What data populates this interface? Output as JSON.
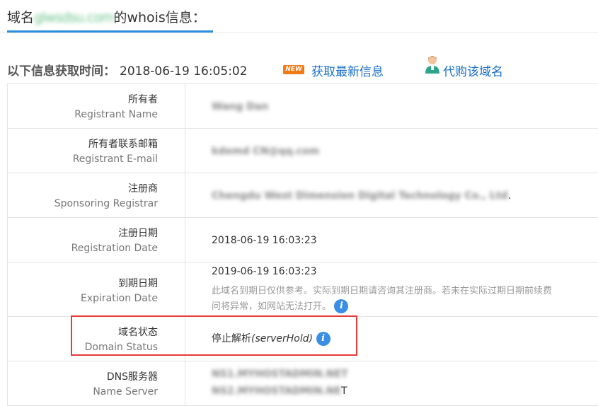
{
  "header": {
    "title_prefix": "域名",
    "title_domain": "glwsdsu.com",
    "title_suffix": "的whois信息："
  },
  "info_bar": {
    "label": "以下信息获取时间：",
    "time": "2018-06-19 16:05:02",
    "new_badge": "NEW",
    "refresh_link": "获取最新信息",
    "buy_link": "代购该域名"
  },
  "rows": {
    "registrant_name": {
      "zh": "所有者",
      "en": "Registrant Name",
      "value": "Wang Dan"
    },
    "registrant_email": {
      "zh": "所有者联系邮箱",
      "en": "Registrant E-mail",
      "value": "kdemd CN@qq.com"
    },
    "registrar": {
      "zh": "注册商",
      "en": "Sponsoring Registrar",
      "value": "Chengdu West Dimension Digital Technology Co., Ltd",
      "value_tail": "."
    },
    "registration_date": {
      "zh": "注册日期",
      "en": "Registration Date",
      "value": "2018-06-19 16:03:23"
    },
    "expiration_date": {
      "zh": "到期日期",
      "en": "Expiration Date",
      "value": "2019-06-19 16:03:23",
      "note_line1": "此域名到期日仅供参考。实际到期日期请咨询其注册商。若未在实际过期日期前续费",
      "note_line2": "问将异常，如网站无法打开。"
    },
    "domain_status": {
      "zh": "域名状态",
      "en": "Domain Status",
      "value_cn": "停止解析",
      "value_en": "(serverHold)"
    },
    "dns": {
      "zh": "DNS服务器",
      "en": "Name Server",
      "value1": "NS1.MYHOSTADMIN.NET",
      "value2": "NS2.MYHOSTADMIN.NE",
      "value2_tail": "T"
    }
  },
  "colors": {
    "accent_blue": "#2b8fe0",
    "link_blue": "#1a6fc9",
    "highlight_red": "#e53a3a",
    "new_orange": "#f07b16"
  }
}
